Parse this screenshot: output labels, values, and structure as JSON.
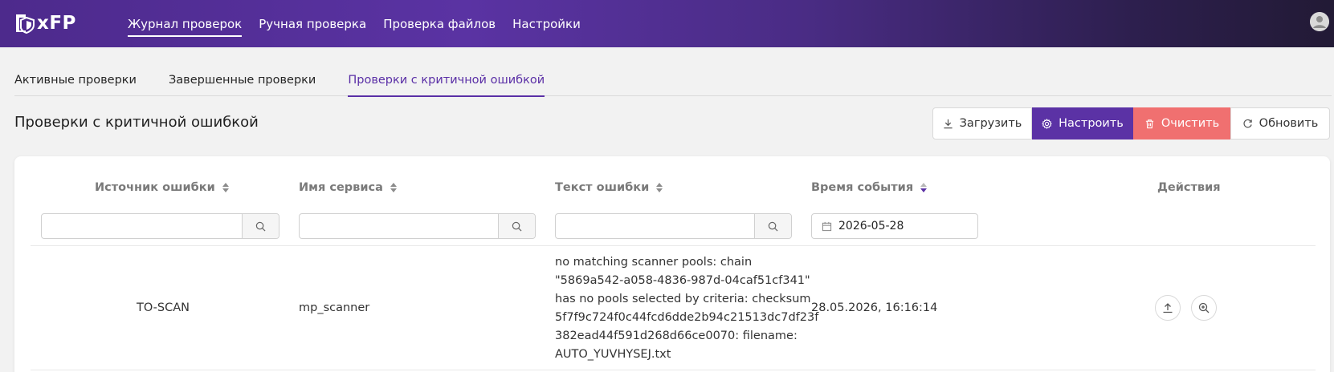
{
  "app": {
    "logo_text": "xFP"
  },
  "nav": {
    "items": [
      {
        "label": "Журнал проверок",
        "active": true
      },
      {
        "label": "Ручная проверка",
        "active": false
      },
      {
        "label": "Проверка файлов",
        "active": false
      },
      {
        "label": "Настройки",
        "active": false
      }
    ]
  },
  "tabs": [
    {
      "label": "Активные проверки",
      "active": false
    },
    {
      "label": "Завершенные проверки",
      "active": false
    },
    {
      "label": "Проверки с критичной ошибкой",
      "active": true
    }
  ],
  "page": {
    "title": "Проверки с критичной ошибкой"
  },
  "toolbar": {
    "upload_label": "Загрузить",
    "configure_label": "Настроить",
    "clear_label": "Очистить",
    "refresh_label": "Обновить"
  },
  "colors": {
    "accent": "#5b32a5",
    "danger": "#f07070",
    "header_start": "#4d2a8c",
    "header_end": "#221a35"
  },
  "table": {
    "columns": [
      {
        "label": "Источник ошибки",
        "sort": "none"
      },
      {
        "label": "Имя сервиса",
        "sort": "none"
      },
      {
        "label": "Текст ошибки",
        "sort": "none"
      },
      {
        "label": "Время события",
        "sort": "descending"
      },
      {
        "label": "Действия"
      }
    ],
    "filters": {
      "source": "",
      "service": "",
      "text": "",
      "date": "2026-05-28"
    },
    "rows": [
      {
        "source": "TO-SCAN",
        "service": "mp_scanner",
        "text_lines": [
          "no matching scanner pools: chain",
          "\"5869a542-a058-4836-987d-04caf51cf341\"",
          "has no pools selected by criteria: checksum",
          "5f7f9c724f0c44fcd6dde2b94c21513dc7df23f",
          "382ead44f591d268d66ce0070: filename:",
          "AUTO_YUVHYSEJ.txt"
        ],
        "time": "28.05.2026, 16:16:14",
        "actions": [
          "upload-icon",
          "zoom-in-icon"
        ]
      }
    ]
  }
}
